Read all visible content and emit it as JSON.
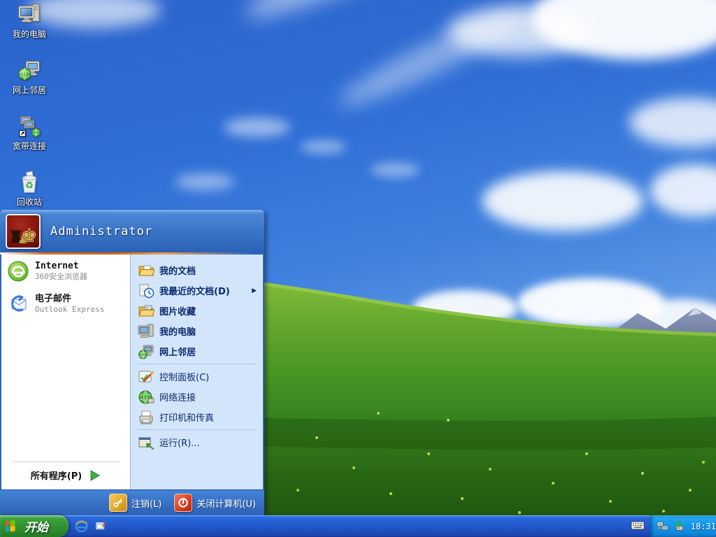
{
  "desktop": {
    "icons": [
      {
        "label": "我的电脑"
      },
      {
        "label": "网上邻居"
      },
      {
        "label": "宽带连接"
      },
      {
        "label": "回收站"
      }
    ]
  },
  "start_menu": {
    "user_name": "Administrator",
    "pinned": [
      {
        "title": "Internet",
        "subtitle": "360安全浏览器"
      },
      {
        "title": "电子邮件",
        "subtitle": "Outlook Express"
      }
    ],
    "right_top": [
      {
        "label": "我的文档"
      },
      {
        "label": "我最近的文档(D)"
      },
      {
        "label": "图片收藏"
      },
      {
        "label": "我的电脑"
      },
      {
        "label": "网上邻居"
      }
    ],
    "right_mid": [
      {
        "label": "控制面板(C)"
      },
      {
        "label": "网络连接"
      },
      {
        "label": "打印机和传真"
      }
    ],
    "right_bottom": [
      {
        "label": "运行(R)..."
      }
    ],
    "all_programs": "所有程序(P)",
    "logoff": "注销(L)",
    "shutdown": "关闭计算机(U)"
  },
  "taskbar": {
    "start": "开始",
    "clock": "18:31"
  },
  "colors": {
    "taskbar_blue": "#2257cc",
    "tray_blue": "#149aec",
    "start_green": "#2f8f2f",
    "menu_header_blue": "#3a76c8",
    "right_column_bg": "#d3e5fa",
    "accent_orange": "#d45f10"
  }
}
